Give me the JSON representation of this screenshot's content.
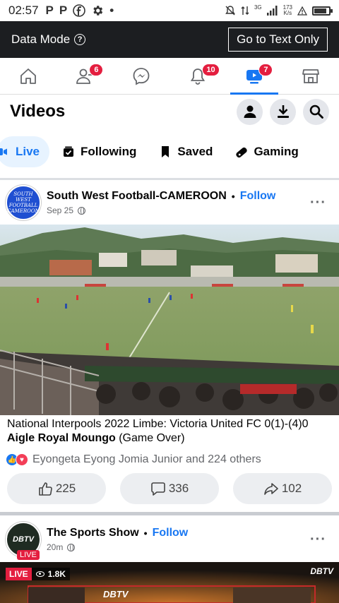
{
  "status_bar": {
    "time": "02:57",
    "left_icons": [
      "p-app-icon",
      "p-app-icon",
      "facebook-icon",
      "gear-icon",
      "dot-icon"
    ],
    "network": "3G",
    "speed_value": "173",
    "speed_unit": "K/s",
    "battery_level": 0.85
  },
  "data_mode": {
    "label": "Data Mode",
    "button": "Go to Text Only"
  },
  "nav": {
    "items": [
      {
        "name": "home",
        "icon": "home-icon",
        "badge": ""
      },
      {
        "name": "friends",
        "icon": "friends-icon",
        "badge": "6"
      },
      {
        "name": "messenger",
        "icon": "messenger-icon",
        "badge": ""
      },
      {
        "name": "notifications",
        "icon": "bell-icon",
        "badge": "10"
      },
      {
        "name": "watch",
        "icon": "watch-icon",
        "badge": "7",
        "active": true
      },
      {
        "name": "marketplace",
        "icon": "store-icon",
        "badge": ""
      }
    ],
    "accent": "#1877f2",
    "badge_color": "#e41e3f"
  },
  "header": {
    "title": "Videos"
  },
  "chips": [
    {
      "label": "Live",
      "icon": "live-icon",
      "active": true
    },
    {
      "label": "Following",
      "icon": "following-icon"
    },
    {
      "label": "Saved",
      "icon": "bookmark-icon"
    },
    {
      "label": "Gaming",
      "icon": "gamepad-icon"
    }
  ],
  "posts": [
    {
      "author": "South West Football-CAMEROON",
      "avatar_text": "SOUTH WEST FOOTBALL CAMEROON",
      "follow": "Follow",
      "time": "Sep 25",
      "caption_main": "National Interpools 2022 Limbe: Victoria United FC 0(1)-(4)0 ",
      "caption_bold": "Aigle Royal Moungo",
      "caption_end": " (Game Over)",
      "reactions_text": "Eyongeta Eyong Jomia Junior and 224 others",
      "likes": "225",
      "comments": "336",
      "shares": "102"
    },
    {
      "author": "The Sports Show",
      "avatar_text": "DBTV",
      "avatar_live": "LIVE",
      "follow": "Follow",
      "time": "20m",
      "live_label": "LIVE",
      "views": "1.8K",
      "watermark": "DBTV",
      "center_logo": "DBTV"
    }
  ]
}
